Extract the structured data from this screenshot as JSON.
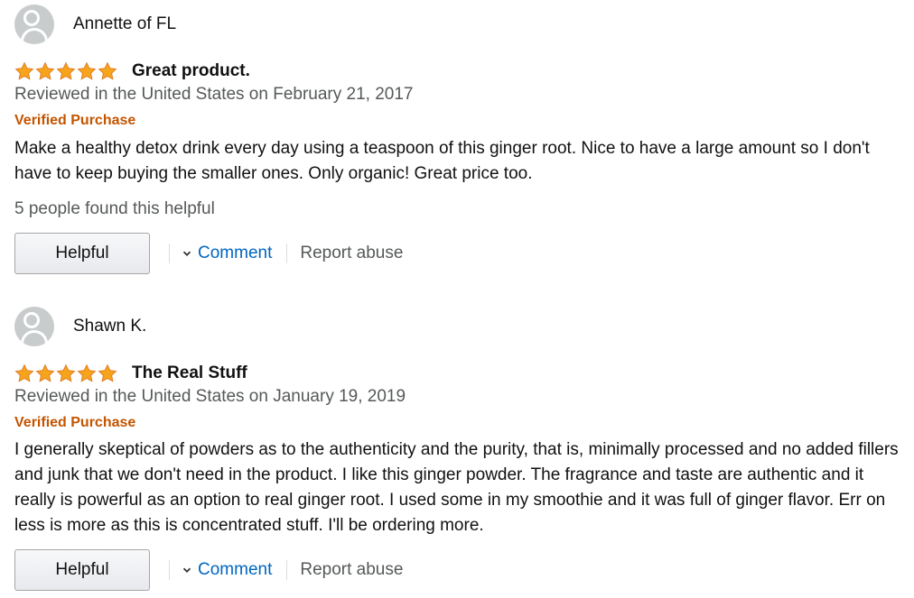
{
  "reviews": [
    {
      "reviewer": "Annette of FL",
      "rating": 5,
      "title": "Great product.",
      "date": "Reviewed in the United States on February 21, 2017",
      "verified": "Verified Purchase",
      "body": "Make a healthy detox drink every day using a teaspoon of this ginger root. Nice to have a large amount so I don't have to keep buying the smaller ones. Only organic! Great price too.",
      "helpful_count": "5 people found this helpful",
      "helpful_label": "Helpful",
      "comment_label": "Comment",
      "report_label": "Report abuse"
    },
    {
      "reviewer": "Shawn K.",
      "rating": 5,
      "title": "The Real Stuff",
      "date": "Reviewed in the United States on January 19, 2019",
      "verified": "Verified Purchase",
      "body": "I generally skeptical of powders as to the authenticity and the purity, that is, minimally processed and no added fillers and junk that we don't need in the product. I like this ginger powder. The fragrance and taste are authentic and it really is powerful as an option to real ginger root. I used some in my smoothie and it was full of ginger flavor. Err on less is more as this is concentrated stuff. I'll be ordering more.",
      "helpful_label": "Helpful",
      "comment_label": "Comment",
      "report_label": "Report abuse"
    }
  ],
  "colors": {
    "star": "#f7a41d",
    "verified": "#c45500",
    "link": "#0066c0",
    "muted": "#565959"
  },
  "icons": {
    "avatar": "default-avatar-icon",
    "star": "star-icon",
    "comment_chevron": "chevron-down-icon"
  }
}
